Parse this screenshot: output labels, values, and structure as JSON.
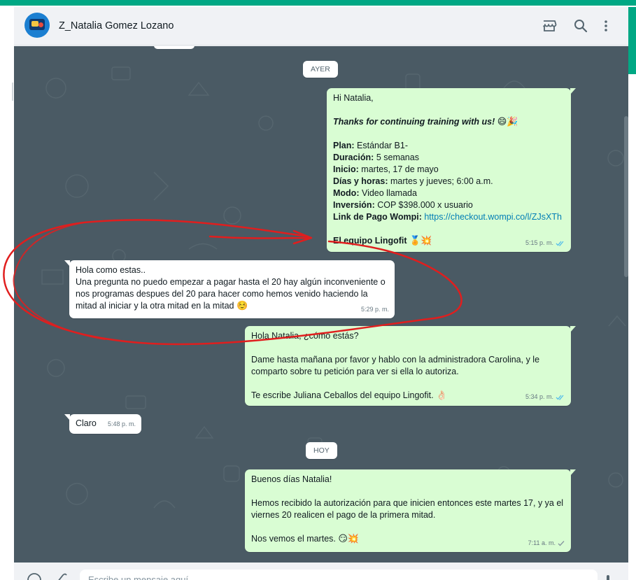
{
  "header": {
    "contact_name": "Z_Natalia Gomez Lozano",
    "icons": [
      "avatar",
      "store-icon",
      "search-icon",
      "menu-dots-icon"
    ]
  },
  "colors": {
    "accent": "#00a884",
    "outgoing_bubble": "#d9fdd3",
    "incoming_bubble": "#ffffff",
    "chat_background": "#4a5a64",
    "link": "#027eb5",
    "read_ticks": "#53bdeb",
    "annotation_red": "#e01e1e"
  },
  "chat": {
    "date_yesterday": "AYER",
    "date_today": "HOY",
    "msg1": {
      "greeting": "Hi Natalia,",
      "thanks": "Thanks for continuing training with us!",
      "thanks_emoji": "😄🎉",
      "plan_label": "Plan:",
      "plan_value": " Estándar B1-",
      "duracion_label": "Duración:",
      "duracion_value": " 5 semanas",
      "inicio_label": "Inicio:",
      "inicio_value": " martes, 17 de mayo",
      "dias_label": "Días y horas:",
      "dias_value": " martes y jueves; 6:00 a.m.",
      "modo_label": "Modo:",
      "modo_value": " Video llamada",
      "inversion_label": "Inversión:",
      "inversion_value": " COP $398.000 x usuario",
      "link_label": "Link de Pago Wompi:",
      "link_value": "https://checkout.wompi.co/l/ZJsXTh",
      "signature": "El equipo Lingofit",
      "signature_emoji": "🏅💥",
      "time": "5:15 p. m.",
      "status": "read"
    },
    "msg2": {
      "line1": "Hola como estas..",
      "line2": "Una pregunta no puedo empezar a pagar hasta el 20 hay algún inconveniente o",
      "line3": "nos programas despues del 20 para hacer como hemos venido haciendo la",
      "line4": "mitad al iniciar y la otra mitad en la mitad",
      "emoji": "☺️",
      "time": "5:29 p. m."
    },
    "msg3": {
      "line1": "Hola Natalia, ¿cómo estás?",
      "line2": "Dame hasta mañana por favor y hablo con la administradora Carolina, y le",
      "line3": "comparto sobre tu petición para ver si ella lo autoriza.",
      "line4": "Te escribe Juliana Ceballos del equipo Lingofit.",
      "emoji": "👌🏻",
      "time": "5:34 p. m.",
      "status": "read"
    },
    "msg4": {
      "text": "Claro",
      "time": "5:48 p. m."
    },
    "msg5": {
      "line1": "Buenos días Natalia!",
      "line2": "Hemos recibido la autorización para que inicien entonces este martes 17, y ya el",
      "line3": "viernes 20 realicen el pago de la primera mitad.",
      "line4": "Nos vemos el martes.",
      "emoji": "😏💥",
      "time": "7:11 a. m.",
      "status": "sent"
    }
  },
  "composer": {
    "placeholder": "Escribe un mensaje aquí"
  }
}
